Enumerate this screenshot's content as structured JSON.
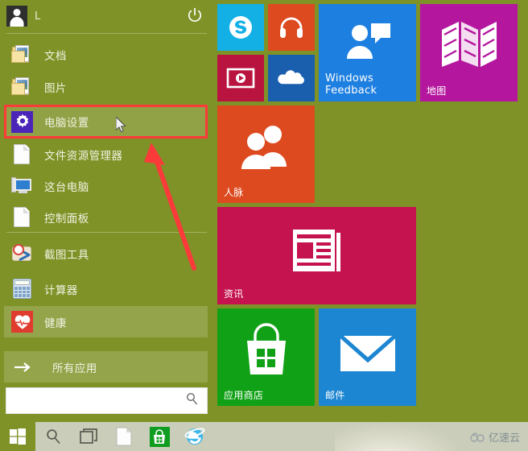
{
  "theme": {
    "menu_green": "#7f9227",
    "menu_green_light": "#8c9e3e",
    "taskbar": "#c9cdb9",
    "annotation_red": "#fb3a3a",
    "text_light": "#f0f3e2"
  },
  "account": {
    "name": "L",
    "avatar_icon": "user-avatar-icon",
    "power_icon": "power-icon"
  },
  "left_panel": {
    "items": [
      {
        "label": "文档",
        "icon": "folder-documents-icon",
        "state": "normal"
      },
      {
        "label": "图片",
        "icon": "folder-pictures-icon",
        "state": "normal"
      },
      {
        "label": "电脑设置",
        "icon": "gear-settings-icon",
        "state": "hovered"
      },
      {
        "label": "文件资源管理器",
        "icon": "file-explorer-icon",
        "state": "normal"
      },
      {
        "label": "这台电脑",
        "icon": "this-pc-icon",
        "state": "normal"
      },
      {
        "label": "控制面板",
        "icon": "control-panel-icon",
        "state": "normal"
      },
      {
        "label": "截图工具",
        "icon": "snipping-tool-icon",
        "state": "normal"
      },
      {
        "label": "计算器",
        "icon": "calculator-icon",
        "state": "normal"
      },
      {
        "label": "健康",
        "icon": "health-heart-icon",
        "state": "selected"
      }
    ],
    "all_apps": {
      "label": "所有应用",
      "icon": "arrow-right-icon"
    },
    "search": {
      "value": "",
      "placeholder": "",
      "icon": "search-icon"
    }
  },
  "tiles": [
    {
      "name": "skype",
      "label": "",
      "color": "#13b0e6",
      "glyph": "skype-icon"
    },
    {
      "name": "music",
      "label": "",
      "color": "#dd4a20",
      "glyph": "headphones-icon"
    },
    {
      "name": "video",
      "label": "",
      "color": "#b8143f",
      "glyph": "video-icon"
    },
    {
      "name": "onedrive",
      "label": "",
      "color": "#1a5fae",
      "glyph": "cloud-icon"
    },
    {
      "name": "windows-feedback",
      "label": "Windows\nFeedback",
      "color": "#1d7fe0",
      "glyph": "feedback-person-icon"
    },
    {
      "name": "maps",
      "label": "地图",
      "color": "#b4179e",
      "glyph": "map-icon"
    },
    {
      "name": "people",
      "label": "人脉",
      "color": "#dd4a20",
      "glyph": "people-icon"
    },
    {
      "name": "news",
      "label": "资讯",
      "color": "#c4134f",
      "glyph": "news-icon"
    },
    {
      "name": "store",
      "label": "应用商店",
      "color": "#11a117",
      "glyph": "store-bag-icon"
    },
    {
      "name": "mail",
      "label": "邮件",
      "color": "#1c86d2",
      "glyph": "mail-envelope-icon"
    }
  ],
  "taskbar": {
    "start_icon": "windows-logo-icon",
    "items": [
      {
        "name": "search",
        "icon": "search-icon"
      },
      {
        "name": "task-view",
        "icon": "task-view-icon"
      },
      {
        "name": "file-explorer",
        "icon": "file-explorer-icon"
      },
      {
        "name": "store",
        "icon": "store-bag-icon"
      },
      {
        "name": "internet-explorer",
        "icon": "internet-explorer-icon"
      }
    ]
  },
  "watermark": {
    "text": "亿速云",
    "icon": "cloud-logo-icon"
  }
}
